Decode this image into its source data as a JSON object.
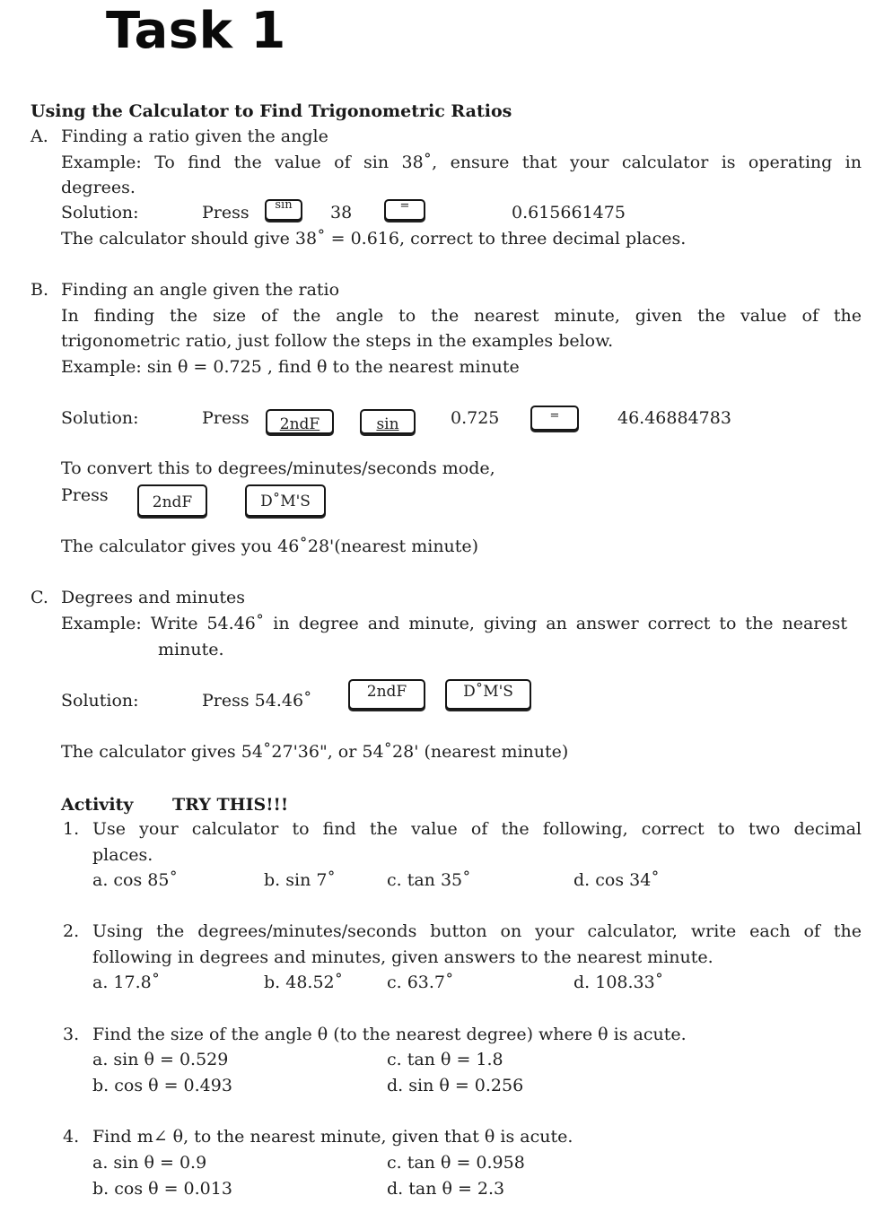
{
  "page": {
    "title": "Task 1",
    "subtitle": "Using the Calculator to Find Trigonometric Ratios"
  },
  "sectionA": {
    "label": "A.",
    "heading": "Finding a ratio given the angle",
    "example_line1": "Example: To find the value of sin 38˚, ensure that your calculator is operating in",
    "example_line2": "degrees.",
    "solution_label": "Solution:",
    "press_label": "Press",
    "key1": "sin",
    "input_value": "38",
    "key2": "=",
    "result": "0.615661475",
    "conclusion": "The calculator should give 38˚ = 0.616, correct to three decimal places."
  },
  "sectionB": {
    "label": "B.",
    "heading": "Finding an angle given the ratio",
    "intro_line1": "In finding the size of the angle to the nearest minute, given the value of the",
    "intro_line2": "trigonometric ratio, just follow the steps in the examples below.",
    "example": "Example:  sin θ = 0.725 , find θ to the nearest minute",
    "solution_label": "Solution:",
    "press_label": "Press",
    "key1": "2ndF",
    "key2": "sin",
    "input_value": "0.725",
    "key3": "=",
    "result": "46.46884783",
    "convert_text": "To convert this to degrees/minutes/seconds mode,",
    "press_label2": "Press",
    "key4": "2ndF",
    "key5": "D˚M'S",
    "conclusion": "The calculator gives you 46˚28'(nearest minute)"
  },
  "sectionC": {
    "label": "C.",
    "heading": "Degrees and minutes",
    "example_line1": "Example: Write 54.46˚ in degree and minute, giving an answer correct to the nearest",
    "example_line2": "minute.",
    "solution_label": "Solution:",
    "press_label": "Press  54.46˚",
    "key1": "2ndF",
    "key2": "D˚M'S",
    "conclusion": "The calculator gives 54˚27'36\", or 54˚28' (nearest minute)"
  },
  "activity": {
    "label": "Activity",
    "tagline": "TRY THIS!!!",
    "questions": [
      {
        "number": "1.",
        "text_line1": "Use your calculator to find the value of the following, correct to two decimal",
        "text_line2": "places.",
        "items": [
          "a.  cos 85˚",
          "b. sin 7˚",
          "c. tan 35˚",
          "d. cos 34˚"
        ]
      },
      {
        "number": "2.",
        "text_line1": "Using the degrees/minutes/seconds button on your calculator, write each of the",
        "text_line2": "following in degrees and minutes, given answers to the nearest minute.",
        "items": [
          "a.  17.8˚",
          "b. 48.52˚",
          "c. 63.7˚",
          "d. 108.33˚"
        ]
      },
      {
        "number": "3.",
        "text_line1": "Find the size of the angle θ (to the nearest degree) where θ is acute.",
        "items": [
          "a.  sin θ = 0.529",
          "b.  cos θ = 0.493",
          "c. tan θ = 1.8",
          "d. sin θ = 0.256"
        ]
      },
      {
        "number": "4.",
        "text_line1": "Find m∠ θ, to the nearest minute, given that θ is acute.",
        "items": [
          "a.  sin θ = 0.9",
          "b.  cos θ = 0.013",
          "c. tan θ = 0.958",
          "d. tan θ = 2.3"
        ]
      }
    ]
  }
}
